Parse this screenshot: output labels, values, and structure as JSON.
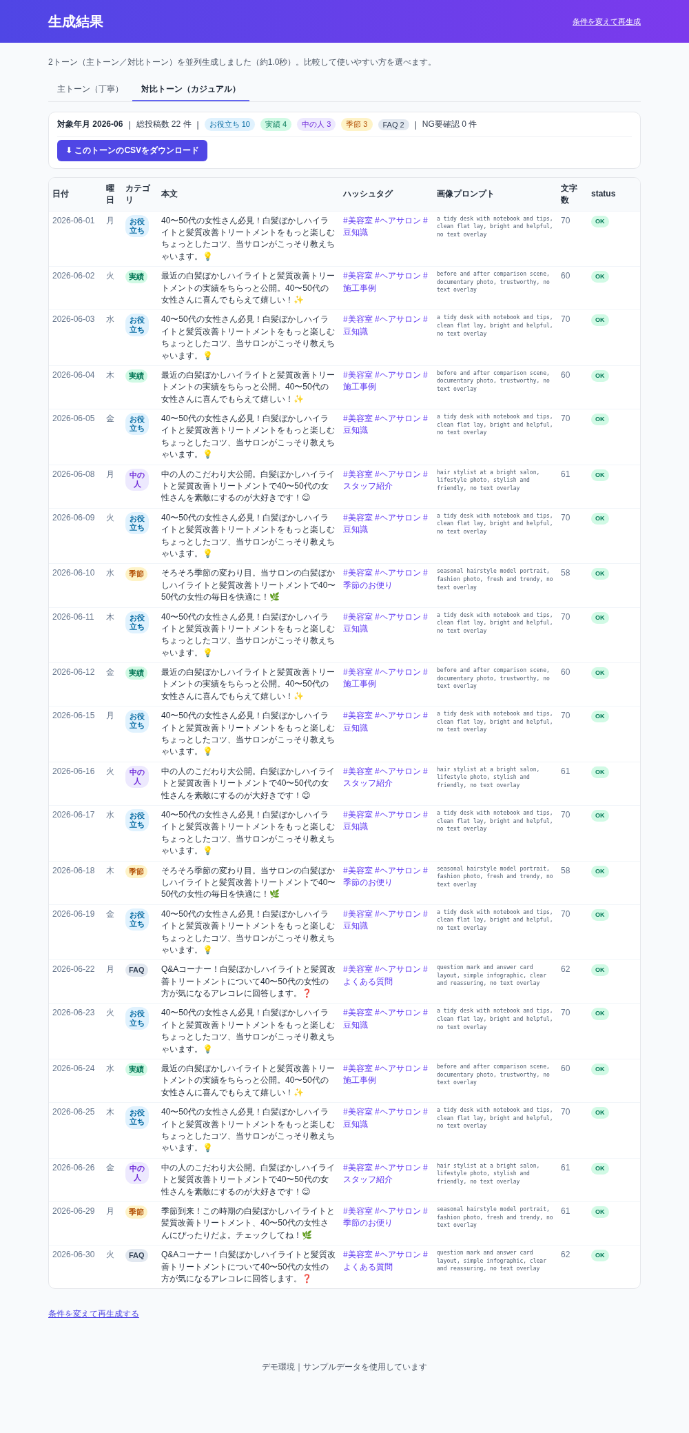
{
  "header": {
    "title": "生成結果",
    "link": "条件を変えて再生成"
  },
  "intro": "2トーン（主トーン／対比トーン）を並列生成しました（約1.0秒）。比較して使いやすい方を選べます。",
  "tabs": [
    {
      "label": "主トーン（丁寧）",
      "selected": false
    },
    {
      "label": "対比トーン（カジュアル）",
      "selected": true
    }
  ],
  "summary": {
    "month_label": "対象年月 2026-06",
    "total": "総投稿数 22 件",
    "separator": "|",
    "chips": [
      {
        "label": "お役立ち 10",
        "kind": "tips"
      },
      {
        "label": "実績 4",
        "kind": "results"
      },
      {
        "label": "中の人 3",
        "kind": "staff"
      },
      {
        "label": "季節 3",
        "kind": "season"
      },
      {
        "label": "FAQ 2",
        "kind": "faq"
      }
    ],
    "ng": "NG要確認 0 件",
    "download_button": "⬇ このトーンのCSVをダウンロード"
  },
  "table": {
    "columns": [
      "日付",
      "曜日",
      "カテゴリ",
      "本文",
      "ハッシュタグ",
      "画像プロンプト",
      "文字数",
      "status"
    ],
    "rows": [
      {
        "date": "2026-06-01",
        "weekday": "月",
        "category": {
          "label": "お役立ち",
          "kind": "tips"
        },
        "body": "40〜50代の女性さん必見！白髪ぼかしハイライトと髪質改善トリートメントをもっと楽しむちょっとしたコツ、当サロンがこっそり教えちゃいます。💡",
        "hashtags": "#美容室 #ヘアサロン #豆知識",
        "prompt": "a tidy desk with notebook and tips, clean flat lay, bright and helpful, no text overlay",
        "count": "70",
        "status": "OK"
      },
      {
        "date": "2026-06-02",
        "weekday": "火",
        "category": {
          "label": "実績",
          "kind": "results"
        },
        "body": "最近の白髪ぼかしハイライトと髪質改善トリートメントの実績をちらっと公開。40〜50代の女性さんに喜んでもらえて嬉しい！✨",
        "hashtags": "#美容室 #ヘアサロン #施工事例",
        "prompt": "before and after comparison scene, documentary photo, trustworthy, no text overlay",
        "count": "60",
        "status": "OK"
      },
      {
        "date": "2026-06-03",
        "weekday": "水",
        "category": {
          "label": "お役立ち",
          "kind": "tips"
        },
        "body": "40〜50代の女性さん必見！白髪ぼかしハイライトと髪質改善トリートメントをもっと楽しむちょっとしたコツ、当サロンがこっそり教えちゃいます。💡",
        "hashtags": "#美容室 #ヘアサロン #豆知識",
        "prompt": "a tidy desk with notebook and tips, clean flat lay, bright and helpful, no text overlay",
        "count": "70",
        "status": "OK"
      },
      {
        "date": "2026-06-04",
        "weekday": "木",
        "category": {
          "label": "実績",
          "kind": "results"
        },
        "body": "最近の白髪ぼかしハイライトと髪質改善トリートメントの実績をちらっと公開。40〜50代の女性さんに喜んでもらえて嬉しい！✨",
        "hashtags": "#美容室 #ヘアサロン #施工事例",
        "prompt": "before and after comparison scene, documentary photo, trustworthy, no text overlay",
        "count": "60",
        "status": "OK"
      },
      {
        "date": "2026-06-05",
        "weekday": "金",
        "category": {
          "label": "お役立ち",
          "kind": "tips"
        },
        "body": "40〜50代の女性さん必見！白髪ぼかしハイライトと髪質改善トリートメントをもっと楽しむちょっとしたコツ、当サロンがこっそり教えちゃいます。💡",
        "hashtags": "#美容室 #ヘアサロン #豆知識",
        "prompt": "a tidy desk with notebook and tips, clean flat lay, bright and helpful, no text overlay",
        "count": "70",
        "status": "OK"
      },
      {
        "date": "2026-06-08",
        "weekday": "月",
        "category": {
          "label": "中の人",
          "kind": "staff"
        },
        "body": "中の人のこだわり大公開。白髪ぼかしハイライトと髪質改善トリートメントで40〜50代の女性さんを素敵にするのが大好きです！😊",
        "hashtags": "#美容室 #ヘアサロン #スタッフ紹介",
        "prompt": "hair stylist at a bright salon, lifestyle photo, stylish and friendly, no text overlay",
        "count": "61",
        "status": "OK"
      },
      {
        "date": "2026-06-09",
        "weekday": "火",
        "category": {
          "label": "お役立ち",
          "kind": "tips"
        },
        "body": "40〜50代の女性さん必見！白髪ぼかしハイライトと髪質改善トリートメントをもっと楽しむちょっとしたコツ、当サロンがこっそり教えちゃいます。💡",
        "hashtags": "#美容室 #ヘアサロン #豆知識",
        "prompt": "a tidy desk with notebook and tips, clean flat lay, bright and helpful, no text overlay",
        "count": "70",
        "status": "OK"
      },
      {
        "date": "2026-06-10",
        "weekday": "水",
        "category": {
          "label": "季節",
          "kind": "season"
        },
        "body": "そろそろ季節の変わり目。当サロンの白髪ぼかしハイライトと髪質改善トリートメントで40〜50代の女性の毎日を快適に！🌿",
        "hashtags": "#美容室 #ヘアサロン #季節のお便り",
        "prompt": "seasonal hairstyle model portrait, fashion photo, fresh and trendy, no text overlay",
        "count": "58",
        "status": "OK"
      },
      {
        "date": "2026-06-11",
        "weekday": "木",
        "category": {
          "label": "お役立ち",
          "kind": "tips"
        },
        "body": "40〜50代の女性さん必見！白髪ぼかしハイライトと髪質改善トリートメントをもっと楽しむちょっとしたコツ、当サロンがこっそり教えちゃいます。💡",
        "hashtags": "#美容室 #ヘアサロン #豆知識",
        "prompt": "a tidy desk with notebook and tips, clean flat lay, bright and helpful, no text overlay",
        "count": "70",
        "status": "OK"
      },
      {
        "date": "2026-06-12",
        "weekday": "金",
        "category": {
          "label": "実績",
          "kind": "results"
        },
        "body": "最近の白髪ぼかしハイライトと髪質改善トリートメントの実績をちらっと公開。40〜50代の女性さんに喜んでもらえて嬉しい！✨",
        "hashtags": "#美容室 #ヘアサロン #施工事例",
        "prompt": "before and after comparison scene, documentary photo, trustworthy, no text overlay",
        "count": "60",
        "status": "OK"
      },
      {
        "date": "2026-06-15",
        "weekday": "月",
        "category": {
          "label": "お役立ち",
          "kind": "tips"
        },
        "body": "40〜50代の女性さん必見！白髪ぼかしハイライトと髪質改善トリートメントをもっと楽しむちょっとしたコツ、当サロンがこっそり教えちゃいます。💡",
        "hashtags": "#美容室 #ヘアサロン #豆知識",
        "prompt": "a tidy desk with notebook and tips, clean flat lay, bright and helpful, no text overlay",
        "count": "70",
        "status": "OK"
      },
      {
        "date": "2026-06-16",
        "weekday": "火",
        "category": {
          "label": "中の人",
          "kind": "staff"
        },
        "body": "中の人のこだわり大公開。白髪ぼかしハイライトと髪質改善トリートメントで40〜50代の女性さんを素敵にするのが大好きです！😊",
        "hashtags": "#美容室 #ヘアサロン #スタッフ紹介",
        "prompt": "hair stylist at a bright salon, lifestyle photo, stylish and friendly, no text overlay",
        "count": "61",
        "status": "OK"
      },
      {
        "date": "2026-06-17",
        "weekday": "水",
        "category": {
          "label": "お役立ち",
          "kind": "tips"
        },
        "body": "40〜50代の女性さん必見！白髪ぼかしハイライトと髪質改善トリートメントをもっと楽しむちょっとしたコツ、当サロンがこっそり教えちゃいます。💡",
        "hashtags": "#美容室 #ヘアサロン #豆知識",
        "prompt": "a tidy desk with notebook and tips, clean flat lay, bright and helpful, no text overlay",
        "count": "70",
        "status": "OK"
      },
      {
        "date": "2026-06-18",
        "weekday": "木",
        "category": {
          "label": "季節",
          "kind": "season"
        },
        "body": "そろそろ季節の変わり目。当サロンの白髪ぼかしハイライトと髪質改善トリートメントで40〜50代の女性の毎日を快適に！🌿",
        "hashtags": "#美容室 #ヘアサロン #季節のお便り",
        "prompt": "seasonal hairstyle model portrait, fashion photo, fresh and trendy, no text overlay",
        "count": "58",
        "status": "OK"
      },
      {
        "date": "2026-06-19",
        "weekday": "金",
        "category": {
          "label": "お役立ち",
          "kind": "tips"
        },
        "body": "40〜50代の女性さん必見！白髪ぼかしハイライトと髪質改善トリートメントをもっと楽しむちょっとしたコツ、当サロンがこっそり教えちゃいます。💡",
        "hashtags": "#美容室 #ヘアサロン #豆知識",
        "prompt": "a tidy desk with notebook and tips, clean flat lay, bright and helpful, no text overlay",
        "count": "70",
        "status": "OK"
      },
      {
        "date": "2026-06-22",
        "weekday": "月",
        "category": {
          "label": "FAQ",
          "kind": "faq"
        },
        "body": "Q&Aコーナー！白髪ぼかしハイライトと髪質改善トリートメントについて40〜50代の女性の方が気になるアレコレに回答します。❓",
        "hashtags": "#美容室 #ヘアサロン #よくある質問",
        "prompt": "question mark and answer card layout, simple infographic, clear and reassuring, no text overlay",
        "count": "62",
        "status": "OK"
      },
      {
        "date": "2026-06-23",
        "weekday": "火",
        "category": {
          "label": "お役立ち",
          "kind": "tips"
        },
        "body": "40〜50代の女性さん必見！白髪ぼかしハイライトと髪質改善トリートメントをもっと楽しむちょっとしたコツ、当サロンがこっそり教えちゃいます。💡",
        "hashtags": "#美容室 #ヘアサロン #豆知識",
        "prompt": "a tidy desk with notebook and tips, clean flat lay, bright and helpful, no text overlay",
        "count": "70",
        "status": "OK"
      },
      {
        "date": "2026-06-24",
        "weekday": "水",
        "category": {
          "label": "実績",
          "kind": "results"
        },
        "body": "最近の白髪ぼかしハイライトと髪質改善トリートメントの実績をちらっと公開。40〜50代の女性さんに喜んでもらえて嬉しい！✨",
        "hashtags": "#美容室 #ヘアサロン #施工事例",
        "prompt": "before and after comparison scene, documentary photo, trustworthy, no text overlay",
        "count": "60",
        "status": "OK"
      },
      {
        "date": "2026-06-25",
        "weekday": "木",
        "category": {
          "label": "お役立ち",
          "kind": "tips"
        },
        "body": "40〜50代の女性さん必見！白髪ぼかしハイライトと髪質改善トリートメントをもっと楽しむちょっとしたコツ、当サロンがこっそり教えちゃいます。💡",
        "hashtags": "#美容室 #ヘアサロン #豆知識",
        "prompt": "a tidy desk with notebook and tips, clean flat lay, bright and helpful, no text overlay",
        "count": "70",
        "status": "OK"
      },
      {
        "date": "2026-06-26",
        "weekday": "金",
        "category": {
          "label": "中の人",
          "kind": "staff"
        },
        "body": "中の人のこだわり大公開。白髪ぼかしハイライトと髪質改善トリートメントで40〜50代の女性さんを素敵にするのが大好きです！😊",
        "hashtags": "#美容室 #ヘアサロン #スタッフ紹介",
        "prompt": "hair stylist at a bright salon, lifestyle photo, stylish and friendly, no text overlay",
        "count": "61",
        "status": "OK"
      },
      {
        "date": "2026-06-29",
        "weekday": "月",
        "category": {
          "label": "季節",
          "kind": "season"
        },
        "body": "季節到来！この時期の白髪ぼかしハイライトと髪質改善トリートメント、40〜50代の女性さんにぴったりだよ。チェックしてね！🌿",
        "hashtags": "#美容室 #ヘアサロン #季節のお便り",
        "prompt": "seasonal hairstyle model portrait, fashion photo, fresh and trendy, no text overlay",
        "count": "61",
        "status": "OK"
      },
      {
        "date": "2026-06-30",
        "weekday": "火",
        "category": {
          "label": "FAQ",
          "kind": "faq"
        },
        "body": "Q&Aコーナー！白髪ぼかしハイライトと髪質改善トリートメントについて40〜50代の女性の方が気になるアレコレに回答します。❓",
        "hashtags": "#美容室 #ヘアサロン #よくある質問",
        "prompt": "question mark and answer card layout, simple infographic, clear and reassuring, no text overlay",
        "count": "62",
        "status": "OK"
      }
    ]
  },
  "bottom_link": "条件を変えて再生成する",
  "footer": "デモ環境｜サンプルデータを使用しています"
}
